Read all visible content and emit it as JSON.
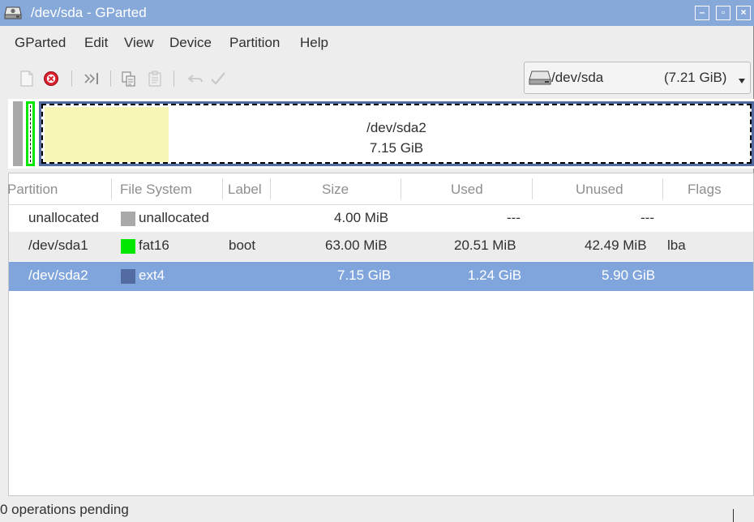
{
  "window": {
    "title": "/dev/sda - GParted",
    "controls": {
      "minimize": "–",
      "maximize": "▫",
      "close": "×"
    }
  },
  "menubar": {
    "items": [
      {
        "label": "GParted"
      },
      {
        "label": "Edit"
      },
      {
        "label": "View"
      },
      {
        "label": "Device"
      },
      {
        "label": "Partition"
      },
      {
        "label": "Help"
      }
    ]
  },
  "toolbar": {
    "buttons": [
      {
        "icon": "new-partition-icon",
        "enabled": false
      },
      {
        "icon": "delete-icon",
        "enabled": true
      },
      {
        "icon": "resize-move-icon",
        "enabled": true
      },
      {
        "icon": "copy-icon",
        "enabled": true
      },
      {
        "icon": "paste-icon",
        "enabled": false
      },
      {
        "icon": "undo-icon",
        "enabled": false
      },
      {
        "icon": "apply-icon",
        "enabled": false
      }
    ]
  },
  "device_selector": {
    "icon": "hard-disk-icon",
    "device": "/dev/sda",
    "size": "(7.21 GiB)"
  },
  "graph": {
    "selected_name": "/dev/sda2",
    "selected_size": "7.15 GiB",
    "colors": {
      "unallocated": "#a9a9a9",
      "fat16": "#00e700",
      "ext4": "#526ba0",
      "used": "#f8f6b7"
    }
  },
  "table": {
    "columns": [
      "Partition",
      "File System",
      "Label",
      "Size",
      "Used",
      "Unused",
      "Flags"
    ],
    "rows": [
      {
        "partition": "unallocated",
        "fs": "unallocated",
        "fs_color": "#a9a9a9",
        "label": "",
        "size": "4.00 MiB",
        "used": "---",
        "unused": "---",
        "flags": ""
      },
      {
        "partition": "/dev/sda1",
        "fs": "fat16",
        "fs_color": "#00e700",
        "label": "boot",
        "size": "63.00 MiB",
        "used": "20.51 MiB",
        "unused": "42.49 MiB",
        "flags": "lba"
      },
      {
        "partition": "/dev/sda2",
        "fs": "ext4",
        "fs_color": "#526ba0",
        "label": "",
        "size": "7.15 GiB",
        "used": "1.24 GiB",
        "unused": "5.90 GiB",
        "flags": ""
      }
    ],
    "selected_row": 2
  },
  "status": {
    "text": "0 operations pending"
  }
}
